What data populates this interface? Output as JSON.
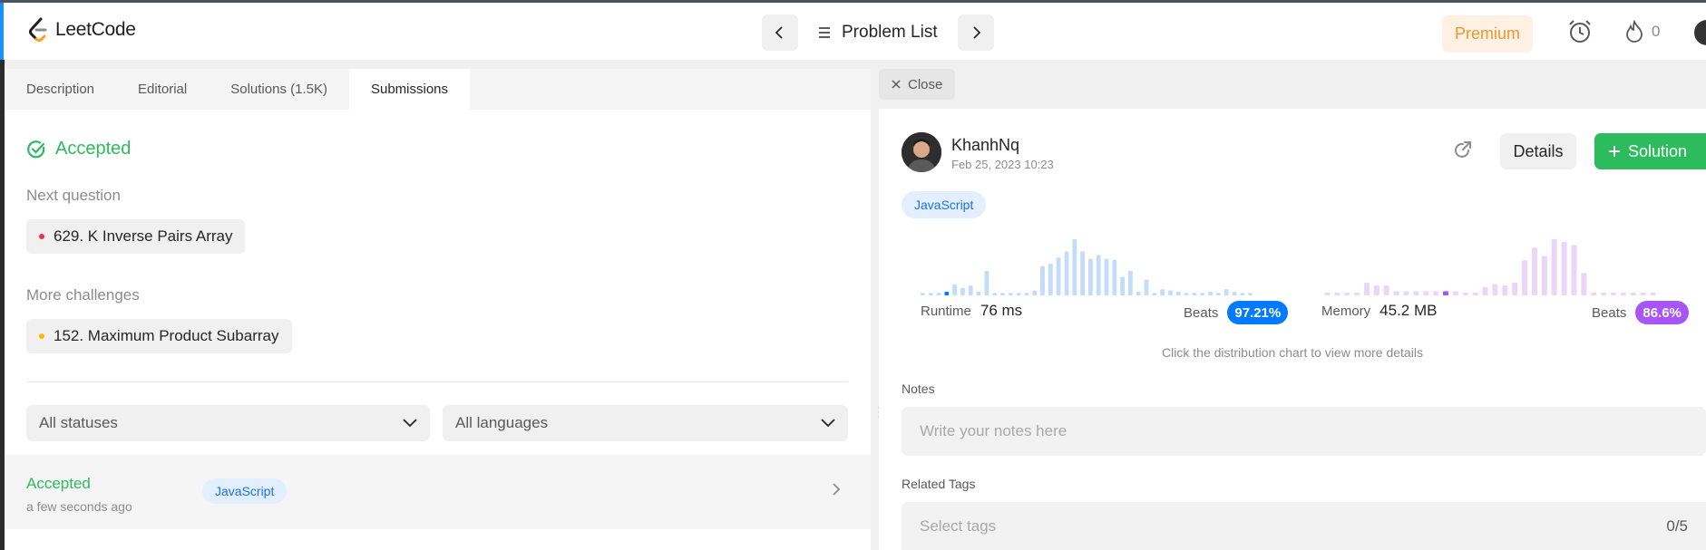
{
  "header": {
    "logo_text": "LeetCode",
    "problem_list_label": "Problem List",
    "premium_label": "Premium",
    "streak_count": "0"
  },
  "tabs": [
    {
      "label": "Description",
      "active": false
    },
    {
      "label": "Editorial",
      "active": false
    },
    {
      "label": "Solutions (1.5K)",
      "active": false
    },
    {
      "label": "Submissions",
      "active": true
    }
  ],
  "result": {
    "status": "Accepted",
    "next_question_label": "Next question",
    "next_question": "629. K Inverse Pairs Array",
    "more_challenges_label": "More challenges",
    "more_challenge": "152. Maximum Product Subarray"
  },
  "filters": {
    "status": "All statuses",
    "language": "All languages"
  },
  "submissions": [
    {
      "status": "Accepted",
      "time": "a few seconds ago",
      "language": "JavaScript"
    }
  ],
  "detail": {
    "close_label": "Close",
    "user_name": "KhanhNq",
    "date": "Feb 25, 2023 10:23",
    "details_label": "Details",
    "solution_label": "Solution",
    "language": "JavaScript",
    "runtime_label": "Runtime",
    "runtime_value": "76 ms",
    "runtime_beats_label": "Beats",
    "runtime_beats": "97.21%",
    "memory_label": "Memory",
    "memory_value": "45.2 MB",
    "memory_beats_label": "Beats",
    "memory_beats": "86.6%",
    "chart_hint": "Click the distribution chart to view more details",
    "notes_label": "Notes",
    "notes_placeholder": "Write your notes here",
    "tags_label": "Related Tags",
    "tags_placeholder": "Select tags",
    "tags_count": "0/5"
  },
  "colors": {
    "accepted_green": "#2cbb5d",
    "runtime_blue": "#007aff",
    "memory_purple": "#a855f7",
    "premium_orange": "#f0962e",
    "hard_red": "#e8354b",
    "medium_yellow": "#ffb800"
  },
  "chart_data": [
    {
      "type": "bar",
      "name": "runtime-distribution",
      "values": [
        2,
        2,
        2,
        3,
        9,
        6,
        8,
        3,
        20,
        2,
        2,
        2,
        2,
        2,
        4,
        24,
        26,
        31,
        36,
        46,
        36,
        30,
        33,
        30,
        29,
        15,
        20,
        3,
        13,
        2,
        5,
        4,
        3,
        2,
        2,
        2,
        3,
        2,
        5,
        3,
        2,
        2
      ],
      "highlight_index": 3
    },
    {
      "type": "bar",
      "name": "memory-distribution",
      "values": [
        2,
        2,
        2,
        2,
        9,
        7,
        7,
        3,
        3,
        3,
        3,
        3,
        3,
        3,
        2,
        2,
        6,
        8,
        7,
        9,
        25,
        34,
        28,
        40,
        38,
        36,
        16,
        2,
        2,
        2,
        2,
        2,
        2,
        2
      ],
      "highlight_index": 12
    }
  ]
}
